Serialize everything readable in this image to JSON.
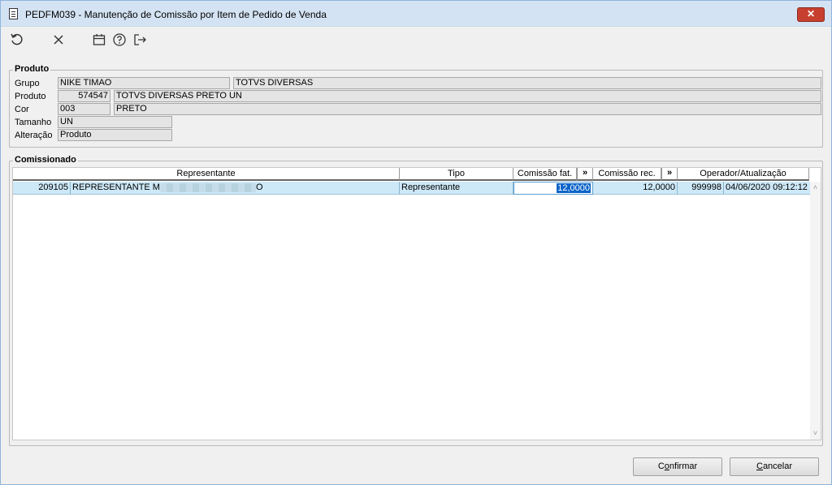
{
  "window": {
    "title": "PEDFM039 - Manutenção de Comissão por Item de Pedido de Venda",
    "close_label": "✕"
  },
  "toolbar": {
    "icons": [
      "refresh-icon",
      "close-icon",
      "calendar-icon",
      "help-icon",
      "exit-icon"
    ]
  },
  "produto": {
    "section_title": "Produto",
    "labels": {
      "grupo": "Grupo",
      "produto": "Produto",
      "cor": "Cor",
      "tamanho": "Tamanho",
      "alteracao": "Alteração"
    },
    "grupo_code": "NIKE TIMAO",
    "grupo_desc": "TOTVS DIVERSAS",
    "produto_code": "574547",
    "produto_desc": "TOTVS DIVERSAS PRETO UN",
    "cor_code": "003",
    "cor_desc": "PRETO",
    "tamanho": "UN",
    "alteracao": "Produto"
  },
  "comissionado": {
    "section_title": "Comissionado",
    "columns": {
      "representante": "Representante",
      "tipo": "Tipo",
      "comissao_fat": "Comissão fat.",
      "comissao_rec": "Comissão rec.",
      "operador": "Operador/Atualização",
      "expand": "»"
    },
    "rows": [
      {
        "code": "209105",
        "name_start": "REPRESENTANTE M",
        "name_end": "O",
        "tipo": "Representante",
        "comissao_fat": "12,0000",
        "comissao_rec": "12,0000",
        "operador": "999998",
        "atualizacao": "04/06/2020 09:12:12"
      }
    ]
  },
  "buttons": {
    "confirmar": {
      "prefix": "C",
      "underline": "o",
      "suffix": "nfirmar"
    },
    "cancelar": {
      "prefix": "",
      "underline": "C",
      "suffix": "ancelar"
    }
  },
  "colors": {
    "titlebar": "#d4e3f3",
    "close": "#c7402f",
    "row_selected": "#cde8f7",
    "text_selection": "#0a64c8"
  }
}
